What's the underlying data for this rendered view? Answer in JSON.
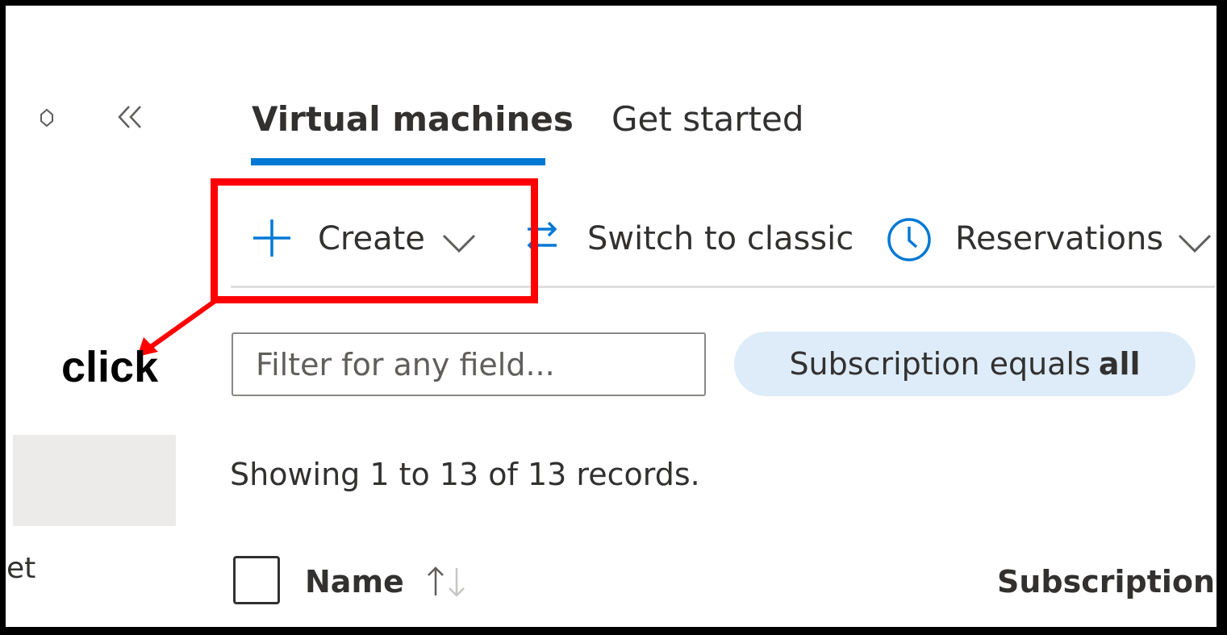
{
  "sidebar": {
    "pin_icon": "pin-icon",
    "collapse_icon": "double-chevron-left-icon",
    "cut_item_text": "et"
  },
  "tabs": [
    {
      "label": "Virtual machines",
      "active": true
    },
    {
      "label": "Get started",
      "active": false
    }
  ],
  "toolbar": {
    "create_label": "Create",
    "switch_label": "Switch to classic",
    "reservations_label": "Reservations"
  },
  "annotation": {
    "text": "click",
    "color": "#ff0000"
  },
  "filter": {
    "placeholder": "Filter for any field..."
  },
  "subscription_pill": {
    "prefix": "Subscription equals",
    "value": "all"
  },
  "status": "Showing 1 to 13 of 13 records.",
  "table": {
    "columns": [
      "Name",
      "Subscription"
    ]
  },
  "colors": {
    "accent": "#0078d4",
    "pill_bg": "#deecf9",
    "selected_bg": "#edebe9"
  }
}
